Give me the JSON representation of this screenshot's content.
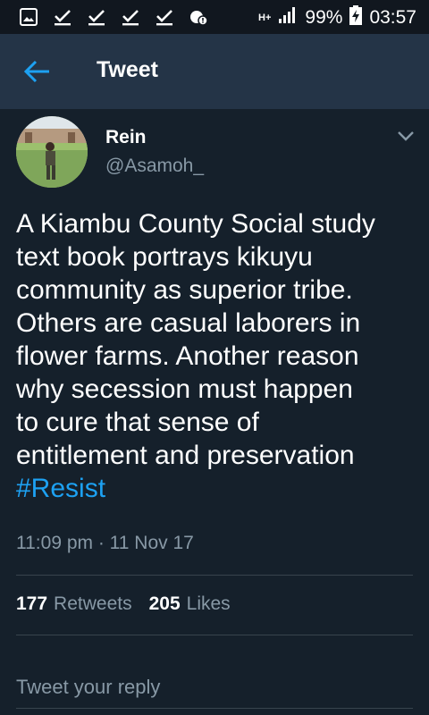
{
  "status_bar": {
    "network": "H+",
    "battery": "99%",
    "time": "03:57"
  },
  "header": {
    "title": "Tweet"
  },
  "tweet": {
    "author_name": "Rein",
    "author_handle": "@Asamoh_",
    "text": "A Kiambu County Social study\ntext book portrays  kikuyu\ncommunity as superior tribe.\nOthers are casual laborers in\nflower farms. Another reason\nwhy secession must happen\nto cure that sense of\nentitlement and preservation",
    "hashtag": "#Resist",
    "timestamp": "11:09 pm · 11 Nov 17",
    "retweets_count": "177",
    "retweets_label": "Retweets",
    "likes_count": "205",
    "likes_label": "Likes"
  },
  "reply": {
    "placeholder": "Tweet your reply"
  },
  "colors": {
    "background": "#15202b",
    "header": "#243447",
    "accent": "#1da1f2",
    "secondary_text": "#8899a6"
  },
  "icons": [
    "gallery-icon",
    "check-icon",
    "check-icon",
    "check-icon",
    "check-icon",
    "cloud-alert-icon",
    "signal-icon",
    "battery-icon",
    "back-arrow-icon",
    "chevron-down-icon"
  ]
}
